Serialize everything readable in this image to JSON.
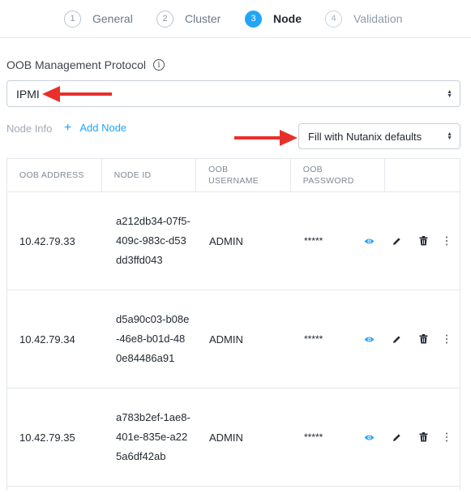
{
  "wizard": {
    "steps": [
      {
        "num": "1",
        "label": "General"
      },
      {
        "num": "2",
        "label": "Cluster"
      },
      {
        "num": "3",
        "label": "Node"
      },
      {
        "num": "4",
        "label": "Validation"
      }
    ],
    "active_step": "3"
  },
  "oob": {
    "label": "OOB Management Protocol",
    "info_icon": "info-icon",
    "selected": "IPMI"
  },
  "node_section": {
    "label": "Node Info",
    "add_label": "Add Node",
    "defaults_selected": "Fill with Nutanix defaults"
  },
  "table": {
    "headers": [
      "OOB ADDRESS",
      "NODE ID",
      "OOB USERNAME",
      "OOB PASSWORD"
    ],
    "rows": [
      {
        "address": "10.42.79.33",
        "node_id": "a212db34-07f5-409c-983c-d53dd3ffd043",
        "username": "ADMIN",
        "password": "*****"
      },
      {
        "address": "10.42.79.34",
        "node_id": "d5a90c03-b08e-46e8-b01d-480e84486a91",
        "username": "ADMIN",
        "password": "*****"
      },
      {
        "address": "10.42.79.35",
        "node_id": "a783b2ef-1ae8-401e-835e-a225a6df42ab",
        "username": "ADMIN",
        "password": "*****"
      }
    ]
  },
  "colors": {
    "accent": "#22a5f7",
    "arrow": "#e8302a"
  }
}
